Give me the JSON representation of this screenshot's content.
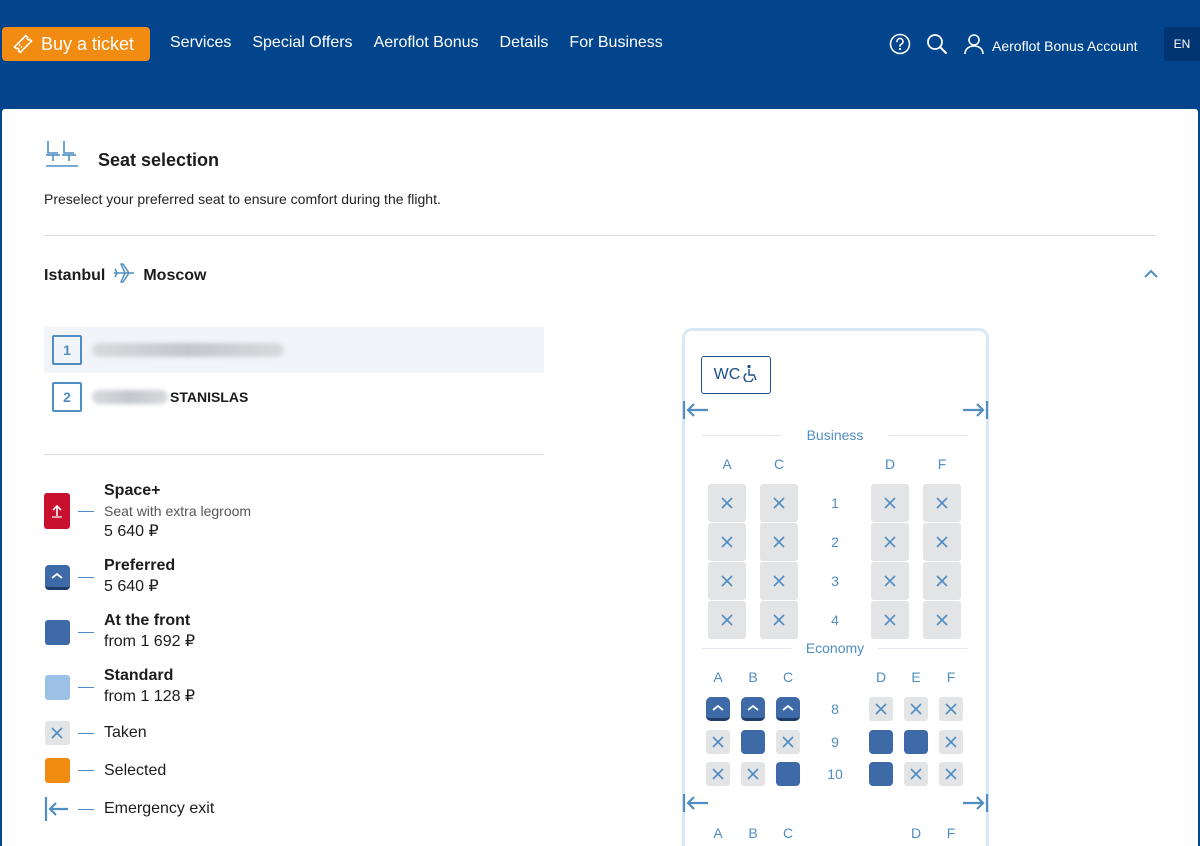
{
  "header": {
    "buy_ticket": "Buy a ticket",
    "nav": [
      "Services",
      "Special Offers",
      "Aeroflot Bonus",
      "Details",
      "For Business"
    ],
    "account": "Aeroflot Bonus Account",
    "lang": "EN",
    "icons": [
      "help-icon",
      "search-icon",
      "user-icon"
    ]
  },
  "seat_selection": {
    "title": "Seat selection",
    "description": "Preselect your preferred seat to ensure comfort during the flight."
  },
  "route": {
    "from": "Istanbul",
    "to": "Moscow"
  },
  "passengers": [
    {
      "number": "1",
      "name_visible": ""
    },
    {
      "number": "2",
      "name_visible": "STANISLAS"
    }
  ],
  "legend": {
    "space_plus": {
      "name": "Space+",
      "desc": "Seat with extra legroom",
      "price": "5 640 ₽"
    },
    "preferred": {
      "name": "Preferred",
      "price": "5 640 ₽"
    },
    "front": {
      "name": "At the front",
      "price": "from 1 692 ₽"
    },
    "standard": {
      "name": "Standard",
      "price": "from 1 128 ₽"
    },
    "taken": "Taken",
    "selected": "Selected",
    "exit": "Emergency exit"
  },
  "seat_map": {
    "wc": "WC",
    "business": {
      "label": "Business",
      "columns": [
        "A",
        "C",
        "D",
        "F"
      ],
      "rows": [
        {
          "number": "1",
          "seats": [
            "taken",
            "taken",
            "taken",
            "taken"
          ]
        },
        {
          "number": "2",
          "seats": [
            "taken",
            "taken",
            "taken",
            "taken"
          ]
        },
        {
          "number": "3",
          "seats": [
            "taken",
            "taken",
            "taken",
            "taken"
          ]
        },
        {
          "number": "4",
          "seats": [
            "taken",
            "taken",
            "taken",
            "taken"
          ]
        }
      ]
    },
    "economy": {
      "label": "Economy",
      "columns": [
        "A",
        "B",
        "C",
        "D",
        "E",
        "F"
      ],
      "rows": [
        {
          "number": "8",
          "seats": [
            "preferred",
            "preferred",
            "preferred",
            "taken",
            "taken",
            "taken"
          ]
        },
        {
          "number": "9",
          "seats": [
            "taken",
            "front",
            "taken",
            "front",
            "front",
            "taken"
          ]
        },
        {
          "number": "10",
          "seats": [
            "taken",
            "taken",
            "front",
            "front",
            "taken",
            "taken"
          ]
        }
      ],
      "bottom_columns": [
        "A",
        "B",
        "C",
        "D",
        "F"
      ]
    }
  },
  "colors": {
    "brand_blue": "#02458d",
    "accent_orange": "#f28b12",
    "space_plus_red": "#c8102e",
    "seat_blue": "#3e6aa8",
    "standard_light": "#9cc0e6",
    "taken_gray": "#e3e4e6",
    "label_blue": "#4f8dc2"
  }
}
